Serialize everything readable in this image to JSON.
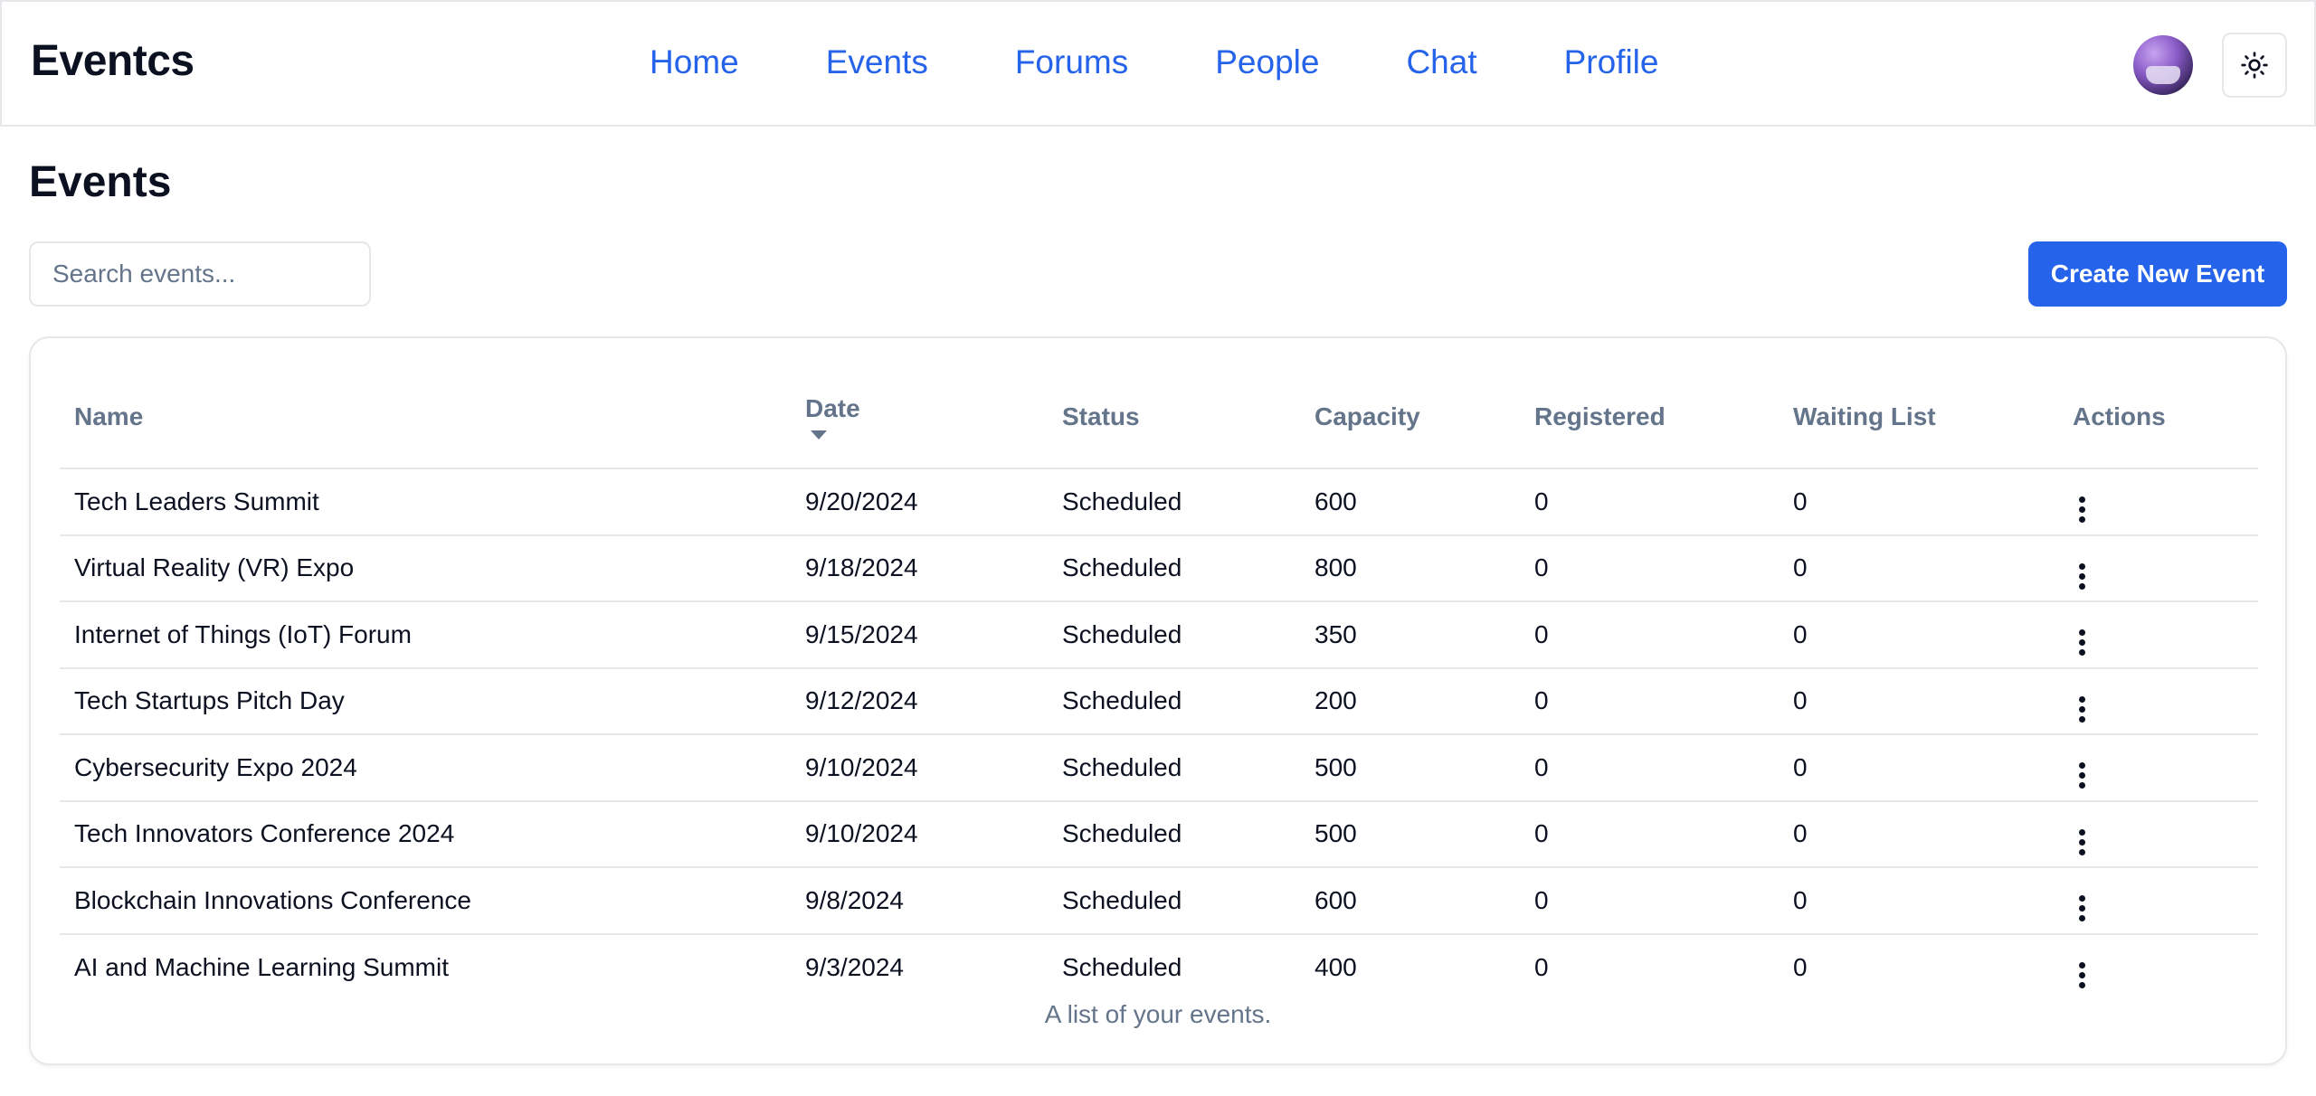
{
  "header": {
    "brand": "Eventcs",
    "nav": [
      {
        "label": "Home"
      },
      {
        "label": "Events"
      },
      {
        "label": "Forums"
      },
      {
        "label": "People"
      },
      {
        "label": "Chat"
      },
      {
        "label": "Profile"
      }
    ],
    "avatar_icon": "user-avatar",
    "theme_icon": "sun-icon"
  },
  "page": {
    "title": "Events",
    "search_placeholder": "Search events...",
    "create_label": "Create New Event"
  },
  "table": {
    "columns": [
      "Name",
      "Date",
      "Status",
      "Capacity",
      "Registered",
      "Waiting List",
      "Actions"
    ],
    "sorted_column": "Date",
    "sort_direction": "descending",
    "rows": [
      {
        "name": "Tech Leaders Summit",
        "date": "9/20/2024",
        "status": "Scheduled",
        "capacity": "600",
        "registered": "0",
        "waiting": "0"
      },
      {
        "name": "Virtual Reality (VR) Expo",
        "date": "9/18/2024",
        "status": "Scheduled",
        "capacity": "800",
        "registered": "0",
        "waiting": "0"
      },
      {
        "name": "Internet of Things (IoT) Forum",
        "date": "9/15/2024",
        "status": "Scheduled",
        "capacity": "350",
        "registered": "0",
        "waiting": "0"
      },
      {
        "name": "Tech Startups Pitch Day",
        "date": "9/12/2024",
        "status": "Scheduled",
        "capacity": "200",
        "registered": "0",
        "waiting": "0"
      },
      {
        "name": "Cybersecurity Expo 2024",
        "date": "9/10/2024",
        "status": "Scheduled",
        "capacity": "500",
        "registered": "0",
        "waiting": "0"
      },
      {
        "name": "Tech Innovators Conference 2024",
        "date": "9/10/2024",
        "status": "Scheduled",
        "capacity": "500",
        "registered": "0",
        "waiting": "0"
      },
      {
        "name": "Blockchain Innovations Conference",
        "date": "9/8/2024",
        "status": "Scheduled",
        "capacity": "600",
        "registered": "0",
        "waiting": "0"
      },
      {
        "name": "AI and Machine Learning Summit",
        "date": "9/3/2024",
        "status": "Scheduled",
        "capacity": "400",
        "registered": "0",
        "waiting": "0"
      }
    ],
    "caption": "A list of your events."
  },
  "colors": {
    "accent": "#2563eb",
    "muted_text": "#64748b",
    "border": "#e5e7eb",
    "text": "#0b1120"
  }
}
